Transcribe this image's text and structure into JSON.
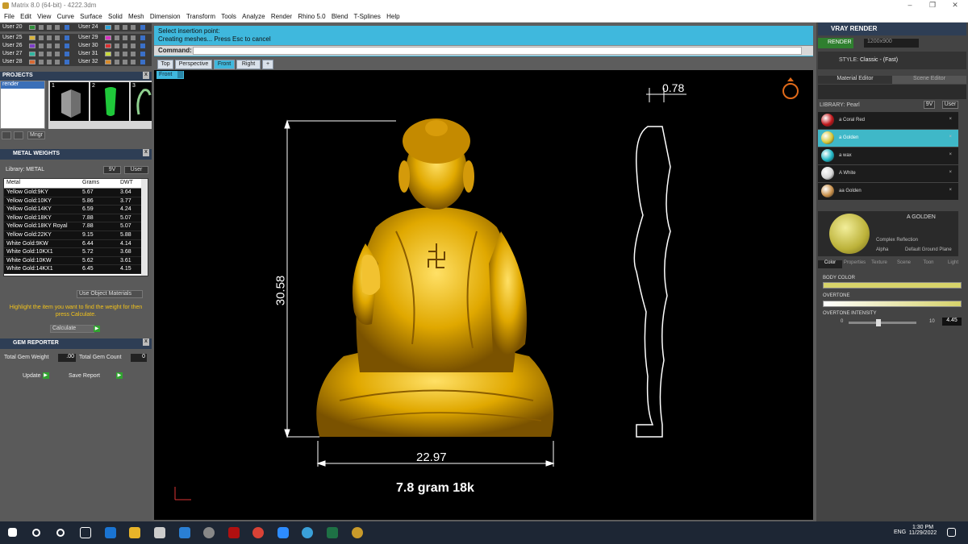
{
  "window": {
    "title": "Matrix 8.0 (64-bit) - 4222.3dm",
    "min": "–",
    "max": "❐",
    "close": "✕"
  },
  "menu": [
    "File",
    "Edit",
    "View",
    "Curve",
    "Surface",
    "Solid",
    "Mesh",
    "Dimension",
    "Transform",
    "Tools",
    "Analyze",
    "Render",
    "Rhino 5.0",
    "Blend",
    "T-Splines",
    "Help"
  ],
  "layers": {
    "left": [
      {
        "name": "User 20",
        "color": "#2f8f3a"
      },
      {
        "name": "User 25",
        "color": "#d9b43a"
      },
      {
        "name": "User 26",
        "color": "#7d3ec7"
      },
      {
        "name": "User 27",
        "color": "#2fb6a0"
      },
      {
        "name": "User 28",
        "color": "#d86a33"
      }
    ],
    "right": [
      {
        "name": "User 24",
        "color": "#2ba4d9"
      },
      {
        "name": "User 29",
        "color": "#d932c2"
      },
      {
        "name": "User 30",
        "color": "#d93232"
      },
      {
        "name": "User 31",
        "color": "#c8d93a"
      },
      {
        "name": "User 32",
        "color": "#d98b2a"
      }
    ]
  },
  "projects": {
    "title": "PROJECTS",
    "item": "render",
    "thumbs": [
      "1",
      "2",
      "3"
    ],
    "mngr_label": "Mngr"
  },
  "metal_weights": {
    "title": "METAL WEIGHTS",
    "library_label": "Library: METAL",
    "btn_9v": "9V",
    "btn_user": "User",
    "columns": [
      "Metal",
      "Grams",
      "DWT"
    ],
    "rows": [
      [
        "Yellow Gold:9KY",
        "5.67",
        "3.64"
      ],
      [
        "Yellow Gold:10KY",
        "5.86",
        "3.77"
      ],
      [
        "Yellow Gold:14KY",
        "6.59",
        "4.24"
      ],
      [
        "Yellow Gold:18KY",
        "7.88",
        "5.07"
      ],
      [
        "Yellow Gold:18KY Royal",
        "7.88",
        "5.07"
      ],
      [
        "Yellow Gold:22KY",
        "9.15",
        "5.88"
      ],
      [
        "White Gold:9KW",
        "6.44",
        "4.14"
      ],
      [
        "White Gold:10KX1",
        "5.72",
        "3.68"
      ],
      [
        "White Gold:10KW",
        "5.62",
        "3.61"
      ],
      [
        "White Gold:14KX1",
        "6.45",
        "4.15"
      ]
    ],
    "use_object_materials": "Use Object Materials",
    "hint": "Highlight the item you want to find the weight for then press Calculate.",
    "calculate": "Calculate"
  },
  "gem_reporter": {
    "title": "GEM REPORTER",
    "total_weight_label": "Total Gem Weight",
    "total_weight_value": ".00",
    "total_count_label": "Total Gem Count",
    "total_count_value": "0",
    "update": "Update",
    "save_report": "Save Report"
  },
  "command": {
    "line1": "Select insertion point:",
    "line2": "Creating meshes... Press Esc to cancel",
    "label": "Command:",
    "value": ""
  },
  "viewport_tabs": [
    "Top",
    "Perspective",
    "Front",
    "Right",
    "+"
  ],
  "active_tab": "Front",
  "viewport_label": "Front",
  "annotations": {
    "top_thickness": "0.78",
    "height": "30.58",
    "width": "22.97",
    "weight_caption": "7.8 gram 18k"
  },
  "vray": {
    "title": "VRAY RENDER",
    "render_btn": "RENDER",
    "resolution": "1200x900",
    "style_label": "STYLE:",
    "style_value": "Classic - (Fast)",
    "tabs": [
      "Material Editor",
      "Scene Editor"
    ],
    "library_label": "LIBRARY: Pearl",
    "library_9v": "9V",
    "library_user": "User",
    "materials": [
      {
        "name": "a Coral Red",
        "color": "#c0161a",
        "selected": false
      },
      {
        "name": "a Golden",
        "color": "#d6c83a",
        "selected": true
      },
      {
        "name": "a wax",
        "color": "#1fb5c4",
        "selected": false
      },
      {
        "name": "A White",
        "color": "#d8d8d8",
        "selected": false
      },
      {
        "name": "aa Golden",
        "color": "#c9904a",
        "selected": false
      }
    ],
    "preview_name": "A GOLDEN",
    "complex_reflection": "Complex Reflection",
    "alpha_label": "Alpha",
    "ground_plane": "Default Ground Plane",
    "sub_tabs": [
      "Color",
      "Properties",
      "Texture",
      "Scene",
      "Toon",
      "Light"
    ],
    "body_color_label": "BODY COLOR",
    "overtone_label": "OVERTONE",
    "overtone_intensity_label": "OVERTONE INTENSITY",
    "intensity_min": "0",
    "intensity_max": "10",
    "intensity_value": "4.45",
    "intensity_fraction": 0.445
  },
  "taskbar": {
    "lang": "ENG",
    "time": "1:30 PM",
    "date": "11/29/2022"
  }
}
